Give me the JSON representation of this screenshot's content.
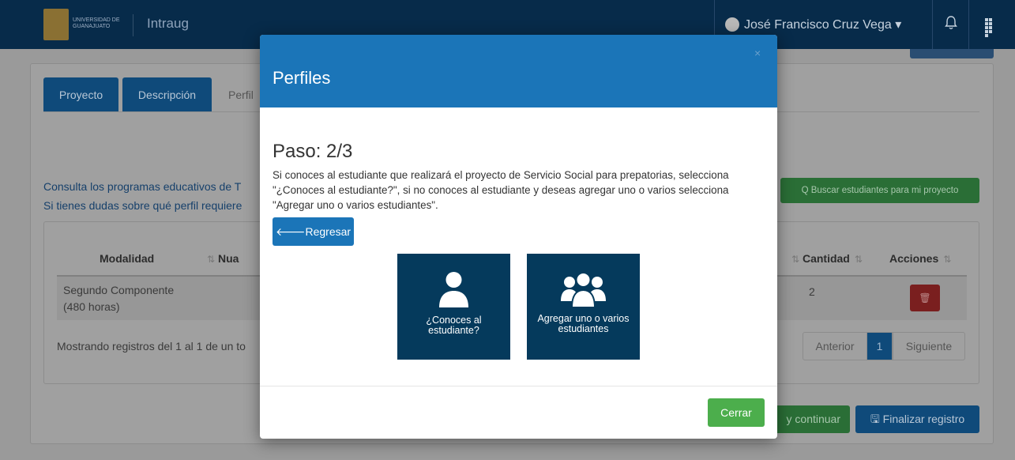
{
  "colors": {
    "modal_header": "#1b75b8",
    "option_card": "#053a5c",
    "close_button": "#4cae4c",
    "navbar": "#072b4a",
    "danger": "#7a1f1f"
  },
  "navbar": {
    "logo_text": "UNIVERSIDAD DE GUANAJUATO",
    "app_name": "Intraug",
    "user_name": "José Francisco Cruz Vega ▾",
    "bell_icon": "bell-icon",
    "apps_icon": "grid-icon"
  },
  "tabs": [
    {
      "label": "Proyecto"
    },
    {
      "label": "Descripción"
    },
    {
      "label": "Perfil"
    }
  ],
  "info": {
    "line1": "Consulta los programas educativos de T",
    "line2": "Si tienes dudas sobre qué perfil requiere"
  },
  "search_button": "Q Buscar estudiantes para mi proyecto",
  "table": {
    "headers": {
      "modalidad": "Modalidad",
      "nua": "Nua",
      "cantidad": "Cantidad",
      "acciones": "Acciones"
    },
    "row": {
      "modalidad_line1": "Segundo Componente",
      "modalidad_line2": "(480 horas)",
      "cantidad": "2"
    },
    "footer": "Mostrando registros del 1 al 1 de un to",
    "pagination": {
      "prev": "Anterior",
      "current": "1",
      "next": "Siguiente"
    }
  },
  "bottom_buttons": {
    "continue": "y continuar",
    "finalize": "🖫 Finalizar registro"
  },
  "modal": {
    "title": "Perfiles",
    "close_symbol": "×",
    "step": "Paso: 2/3",
    "description": "Si conoces al estudiante que realizará el proyecto de Servicio Social para prepatorias, selecciona \"¿Conoces al estudiante?\", si no conoces al estudiante y deseas agregar uno o varios selecciona \"Agregar uno o varios estudiantes\".",
    "back_button": "🡐Regresar",
    "options": [
      {
        "label": "¿Conoces al estudiante?",
        "icon": "user-icon"
      },
      {
        "label": "Agregar uno o varios estudiantes",
        "icon": "users-icon"
      }
    ],
    "close_button": "Cerrar"
  }
}
